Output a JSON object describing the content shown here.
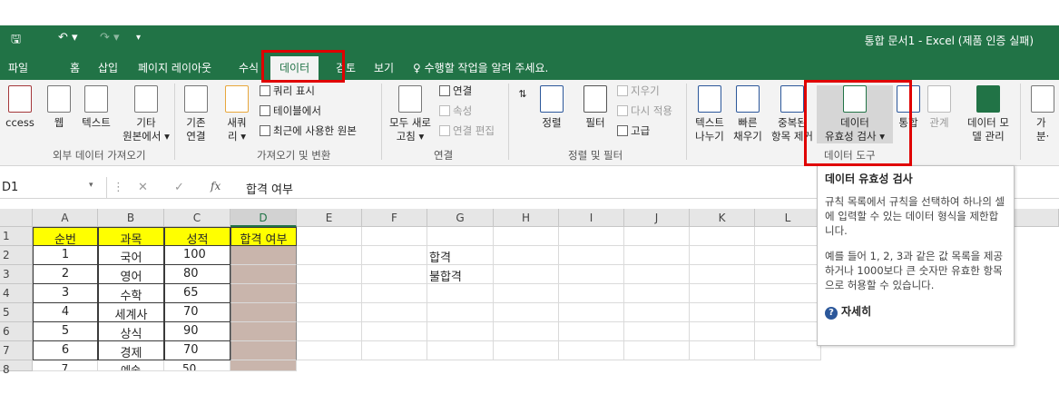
{
  "window": {
    "title": "통합 문서1 - Excel (제품 인증 실패)"
  },
  "tabs": [
    {
      "label": "파일"
    },
    {
      "label": "홈"
    },
    {
      "label": "삽입"
    },
    {
      "label": "페이지 레이아웃"
    },
    {
      "label": "수식"
    },
    {
      "label": "데이터",
      "active": true
    },
    {
      "label": "검토"
    },
    {
      "label": "보기"
    }
  ],
  "tell_me": "수행할 작업을 알려 주세요.",
  "ribbon": {
    "get_external": {
      "group_label": "외부 데이터 가져오기",
      "access": "ccess",
      "web": "웹",
      "text": "텍스트",
      "other_1": "기타",
      "other_2": "원본에서 ▾"
    },
    "get_transform": {
      "group_label": "가져오기 및 변환",
      "existing_1": "기존",
      "existing_2": "연결",
      "newq_1": "새쿼",
      "newq_2": "리 ▾",
      "show_queries": "쿼리 표시",
      "from_table": "테이블에서",
      "recent_sources": "최근에 사용한 원본"
    },
    "connections": {
      "group_label": "연결",
      "refresh_1": "모두 새로",
      "refresh_2": "고침 ▾",
      "connections": "연결",
      "properties": "속성",
      "edit_links": "연결 편집"
    },
    "sort_filter": {
      "group_label": "정렬 및 필터",
      "sort": "정렬",
      "filter": "필터",
      "clear": "지우기",
      "reapply": "다시 적용",
      "advanced": "고급"
    },
    "data_tools": {
      "group_label": "데이터 도구",
      "text_to_col_1": "텍스트",
      "text_to_col_2": "나누기",
      "flash_fill_1": "빠른",
      "flash_fill_2": "채우기",
      "remove_dup_1": "중복된",
      "remove_dup_2": "항목 제거",
      "validation_1": "데이터",
      "validation_2": "유효성 검사 ▾",
      "consolidate": "통합",
      "relationships": "관계",
      "model_1": "데이터 모",
      "model_2": "델 관리",
      "more_1": "가",
      "more_2": "분·"
    }
  },
  "formula_bar": {
    "name_box": "D1",
    "fx": "fx",
    "formula": "합격 여부"
  },
  "grid": {
    "columns": [
      "A",
      "B",
      "C",
      "D",
      "E",
      "F",
      "G",
      "H",
      "I",
      "J",
      "K",
      "L"
    ],
    "row_numbers": [
      "1",
      "2",
      "3",
      "4",
      "5",
      "6",
      "7"
    ],
    "rows": [
      [
        "순번",
        "과목",
        "성적",
        "합격 여부",
        "",
        "",
        "",
        "",
        "",
        "",
        "",
        ""
      ],
      [
        "1",
        "국어",
        "100",
        "",
        "",
        "",
        "합격",
        "",
        "",
        "",
        "",
        ""
      ],
      [
        "2",
        "영어",
        "80",
        "",
        "",
        "",
        "불합격",
        "",
        "",
        "",
        "",
        ""
      ],
      [
        "3",
        "수학",
        "65",
        "",
        "",
        "",
        "",
        "",
        "",
        "",
        "",
        ""
      ],
      [
        "4",
        "세계사",
        "70",
        "",
        "",
        "",
        "",
        "",
        "",
        "",
        "",
        ""
      ],
      [
        "5",
        "상식",
        "90",
        "",
        "",
        "",
        "",
        "",
        "",
        "",
        "",
        ""
      ],
      [
        "6",
        "경제",
        "70",
        "",
        "",
        "",
        "",
        "",
        "",
        "",
        "",
        ""
      ]
    ]
  },
  "tooltip": {
    "title": "데이터 유효성 검사",
    "desc": "규칙 목록에서 규칙을 선택하여 하나의 셀에 입력할 수 있는 데이터 형식을 제한합니다.",
    "example": "예를 들어 1, 2, 3과 같은 값 목록을 제공하거나 1000보다 큰 숫자만 유효한 항목으로 허용할 수 있습니다.",
    "more": "자세히"
  },
  "colors": {
    "excel_green": "#217346",
    "header_fill": "#ffff00",
    "d_column_fill": "#c9b5ac",
    "highlight_red": "#e00000"
  }
}
